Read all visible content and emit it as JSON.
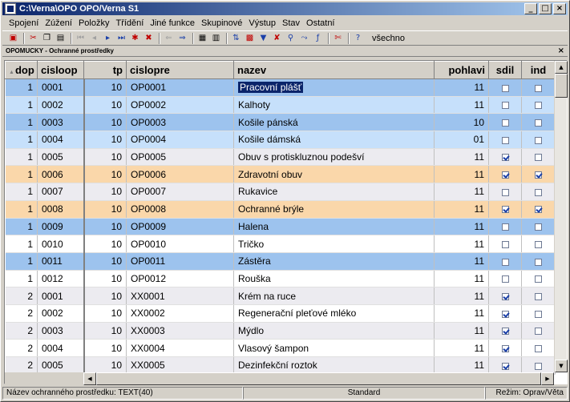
{
  "window": {
    "title": "C:\\Verna\\OPO OPO/Verna S1"
  },
  "title_buttons": {
    "minimize": "_",
    "maximize": "□",
    "close": "×"
  },
  "menu": [
    {
      "label": "Spojení"
    },
    {
      "label": "Zúžení"
    },
    {
      "label": "Položky"
    },
    {
      "label": "Třídění"
    },
    {
      "label": "Jiné funkce"
    },
    {
      "label": "Skupinové"
    },
    {
      "label": "Výstup"
    },
    {
      "label": "Stav"
    },
    {
      "label": "Ostatní"
    }
  ],
  "toolbar": {
    "filter_label": "všechno"
  },
  "panel": {
    "title": "OPOMUCKY - Ochranné prostředky",
    "close": "×"
  },
  "columns": {
    "dop": "dop",
    "cisloop": "cisloop",
    "tp": "tp",
    "cislopre": "cislopre",
    "nazev": "nazev",
    "pohlavi": "pohlavi",
    "sdil": "sdil",
    "ind": "ind"
  },
  "rows": [
    {
      "dop": "1",
      "cisloop": "0001",
      "tp": "10",
      "cislopre": "OP0001",
      "nazev": "Pracovní plášť",
      "pohlavi": "11",
      "sdil": false,
      "ind": false,
      "style": "blue",
      "selected": true
    },
    {
      "dop": "1",
      "cisloop": "0002",
      "tp": "10",
      "cislopre": "OP0002",
      "nazev": "Kalhoty",
      "pohlavi": "11",
      "sdil": false,
      "ind": false,
      "style": "lblue"
    },
    {
      "dop": "1",
      "cisloop": "0003",
      "tp": "10",
      "cislopre": "OP0003",
      "nazev": "Košile pánská",
      "pohlavi": "10",
      "sdil": false,
      "ind": false,
      "style": "blue"
    },
    {
      "dop": "1",
      "cisloop": "0004",
      "tp": "10",
      "cislopre": "OP0004",
      "nazev": "Košile dámská",
      "pohlavi": "01",
      "sdil": false,
      "ind": false,
      "style": "lblue"
    },
    {
      "dop": "1",
      "cisloop": "0005",
      "tp": "10",
      "cislopre": "OP0005",
      "nazev": "Obuv s protiskluznou podešví",
      "pohlavi": "11",
      "sdil": true,
      "ind": false,
      "style": "gray"
    },
    {
      "dop": "1",
      "cisloop": "0006",
      "tp": "10",
      "cislopre": "OP0006",
      "nazev": "Zdravotní obuv",
      "pohlavi": "11",
      "sdil": true,
      "ind": true,
      "style": "orange"
    },
    {
      "dop": "1",
      "cisloop": "0007",
      "tp": "10",
      "cislopre": "OP0007",
      "nazev": "Rukavice",
      "pohlavi": "11",
      "sdil": false,
      "ind": false,
      "style": "gray"
    },
    {
      "dop": "1",
      "cisloop": "0008",
      "tp": "10",
      "cislopre": "OP0008",
      "nazev": "Ochranné brýle",
      "pohlavi": "11",
      "sdil": true,
      "ind": true,
      "style": "orange"
    },
    {
      "dop": "1",
      "cisloop": "0009",
      "tp": "10",
      "cislopre": "OP0009",
      "nazev": "Halena",
      "pohlavi": "11",
      "sdil": false,
      "ind": false,
      "style": "blue"
    },
    {
      "dop": "1",
      "cisloop": "0010",
      "tp": "10",
      "cislopre": "OP0010",
      "nazev": "Tričko",
      "pohlavi": "11",
      "sdil": false,
      "ind": false,
      "style": "white"
    },
    {
      "dop": "1",
      "cisloop": "0011",
      "tp": "10",
      "cislopre": "OP0011",
      "nazev": "Zástěra",
      "pohlavi": "11",
      "sdil": false,
      "ind": false,
      "style": "blue"
    },
    {
      "dop": "1",
      "cisloop": "0012",
      "tp": "10",
      "cislopre": "OP0012",
      "nazev": "Rouška",
      "pohlavi": "11",
      "sdil": false,
      "ind": false,
      "style": "white"
    },
    {
      "dop": "2",
      "cisloop": "0001",
      "tp": "10",
      "cislopre": "XX0001",
      "nazev": "Krém na ruce",
      "pohlavi": "11",
      "sdil": true,
      "ind": false,
      "style": "gray"
    },
    {
      "dop": "2",
      "cisloop": "0002",
      "tp": "10",
      "cislopre": "XX0002",
      "nazev": "Regenerační pleťové mléko",
      "pohlavi": "11",
      "sdil": true,
      "ind": false,
      "style": "white"
    },
    {
      "dop": "2",
      "cisloop": "0003",
      "tp": "10",
      "cislopre": "XX0003",
      "nazev": "Mýdlo",
      "pohlavi": "11",
      "sdil": true,
      "ind": false,
      "style": "gray"
    },
    {
      "dop": "2",
      "cisloop": "0004",
      "tp": "10",
      "cislopre": "XX0004",
      "nazev": "Vlasový šampon",
      "pohlavi": "11",
      "sdil": true,
      "ind": false,
      "style": "white"
    },
    {
      "dop": "2",
      "cisloop": "0005",
      "tp": "10",
      "cislopre": "XX0005",
      "nazev": "Dezinfekční roztok",
      "pohlavi": "11",
      "sdil": true,
      "ind": false,
      "style": "gray"
    }
  ],
  "status": {
    "field": "Název ochranného prostředku: TEXT(40)",
    "mode": "Standard",
    "edit": "Režim: Oprav/Věta"
  }
}
